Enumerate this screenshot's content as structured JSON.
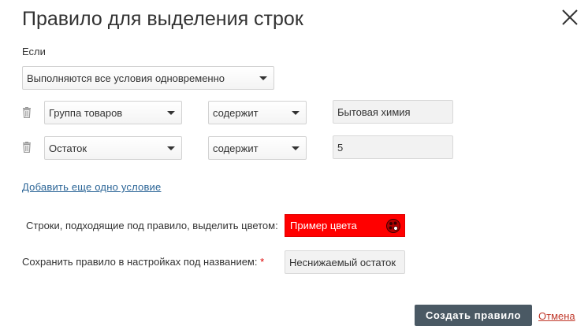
{
  "dialog": {
    "title": "Правило для выделения строк",
    "if_label": "Если",
    "logic_select": "Выполняются все условия одновременно",
    "conditions": [
      {
        "field": "Группа товаров",
        "operator": "содержит",
        "value": "Бытовая химия"
      },
      {
        "field": "Остаток",
        "operator": "содержит",
        "value": "5"
      }
    ],
    "add_condition_link": "Добавить еще одно условие",
    "color_label": "Строки, подходящие под правило, выделить цветом:",
    "color_sample": "Пример цвета",
    "color_value": "#ff0000",
    "save_label": "Сохранить правило в настройках под названием:",
    "required_mark": "*",
    "rule_name": "Неснижаемый остаток",
    "create_button": "Создать правило",
    "cancel_link": "Отмена"
  }
}
